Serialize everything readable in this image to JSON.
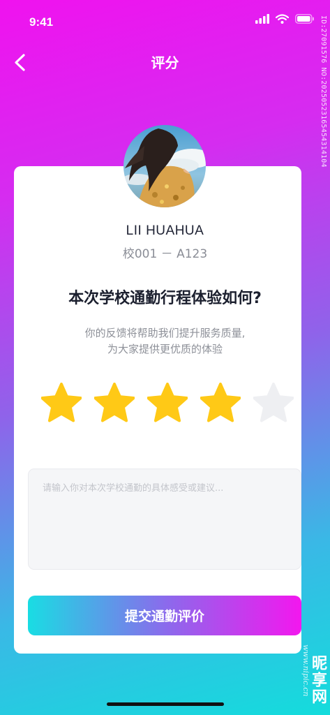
{
  "status_bar": {
    "time": "9:41",
    "icons": [
      "signal-icon",
      "wifi-icon",
      "battery-icon"
    ]
  },
  "nav": {
    "title": "评分",
    "back_icon": "chevron-left-icon"
  },
  "watermark": {
    "id_text": "ID:27091576 NO:20250523165454314104",
    "logo": "昵享网",
    "url": "www.nipic.cn"
  },
  "user": {
    "name": "LII HUAHUA",
    "id": "校001 － A123"
  },
  "question": "本次学校通勤行程体验如何?",
  "subtitle": {
    "line1": "你的反馈将帮助我们提升服务质量,",
    "line2": "为大家提供更优质的体验"
  },
  "rating": {
    "value": 4,
    "max": 5,
    "active_color": "#ffc916",
    "inactive_color": "#eeeff2"
  },
  "feedback": {
    "placeholder": "请输入你对本次学校通勤的具体感受或建议...",
    "value": ""
  },
  "submit_label": "提交通勤评价",
  "colors": {
    "bg_top": "#f012ef",
    "bg_bottom": "#14dcdc",
    "button_start": "#19dde3",
    "button_end": "#f317ee"
  }
}
